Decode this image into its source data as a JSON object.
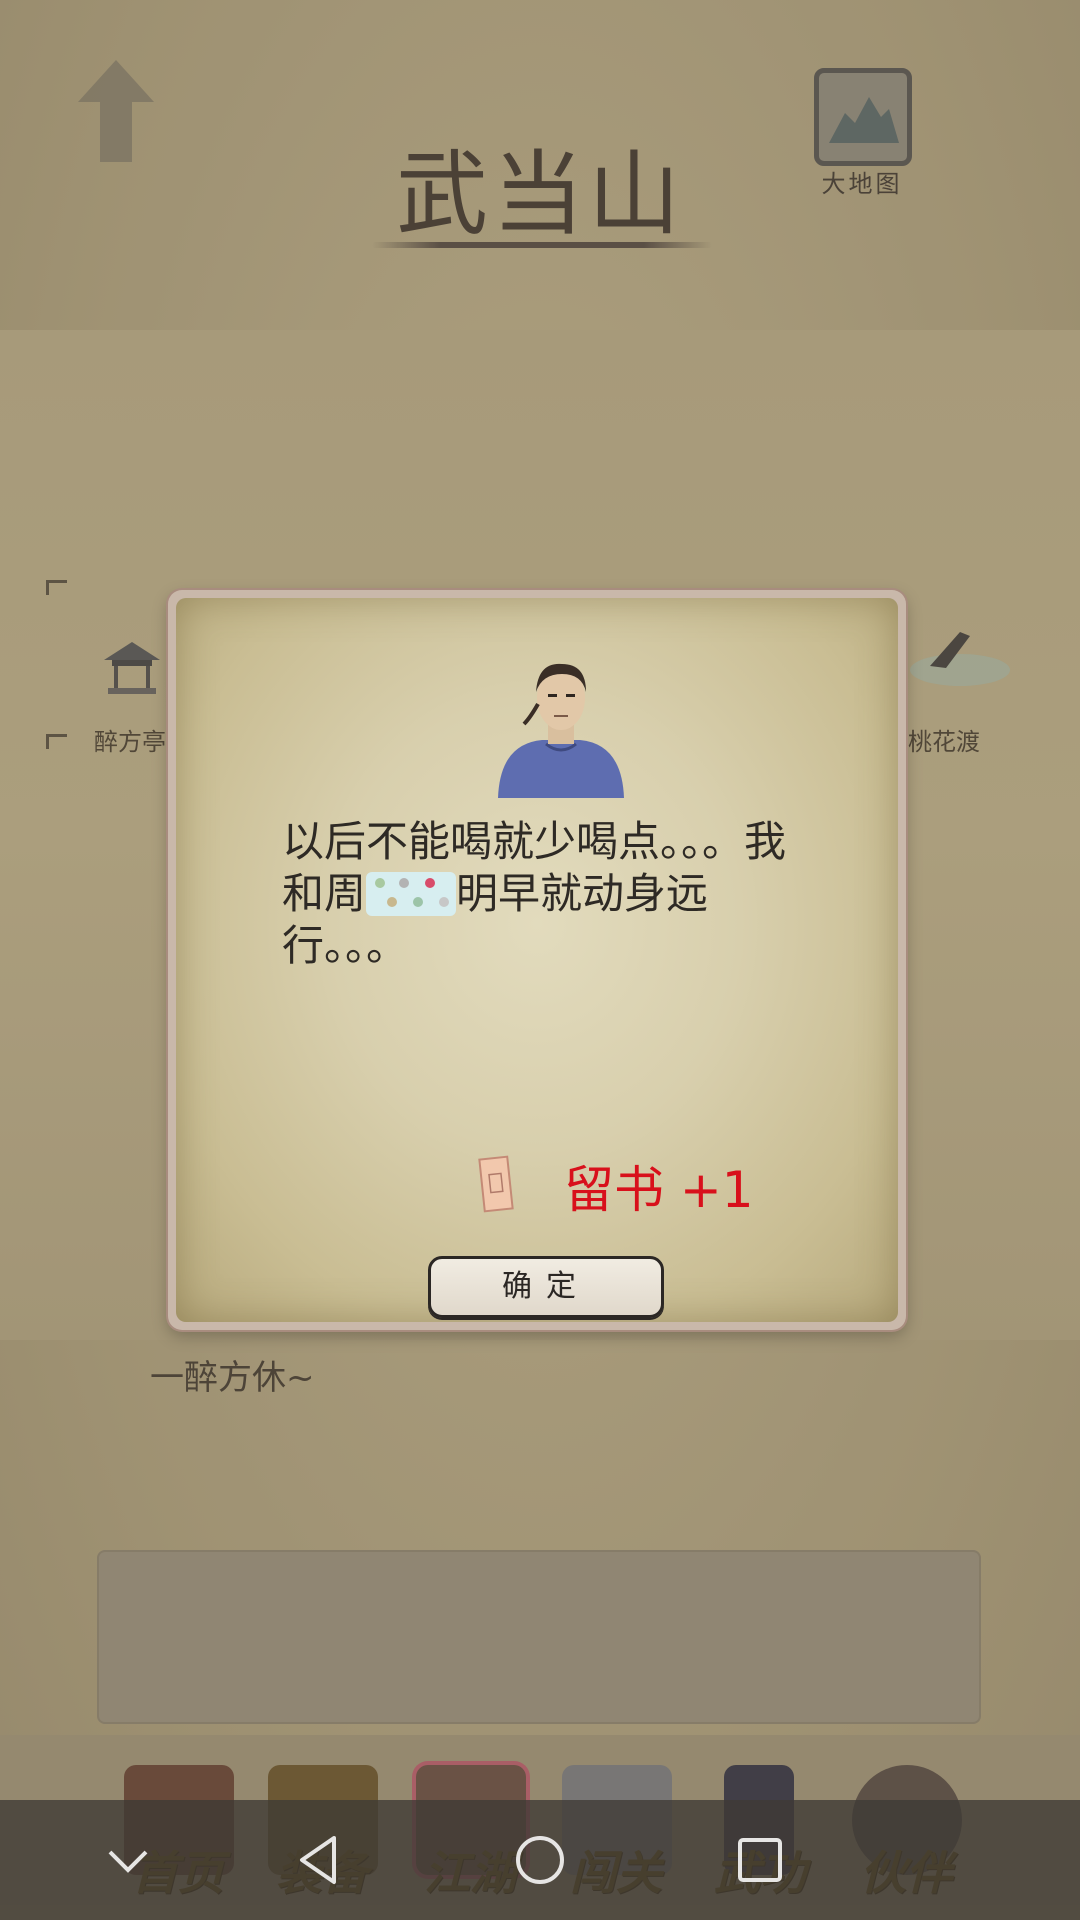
{
  "header": {
    "title": "武当山",
    "map_button_label": "大地图"
  },
  "map": {
    "locations": [
      {
        "name": "醉方亭"
      },
      {
        "name": "桃花渡"
      }
    ]
  },
  "flavor_text": "一醉方休~",
  "dialog": {
    "text_before": "以后不能喝就少喝点。。。我和周",
    "text_after": "明早就动身远行。。。",
    "reward_label": "留书 +1",
    "confirm_label": "确定"
  },
  "tabs": [
    {
      "label": "首页"
    },
    {
      "label": "装备"
    },
    {
      "label": "江湖"
    },
    {
      "label": "闯关"
    },
    {
      "label": "武功"
    },
    {
      "label": "伙伴"
    }
  ],
  "colors": {
    "reward": "#d8101b",
    "tab_label": "#6b5316"
  }
}
